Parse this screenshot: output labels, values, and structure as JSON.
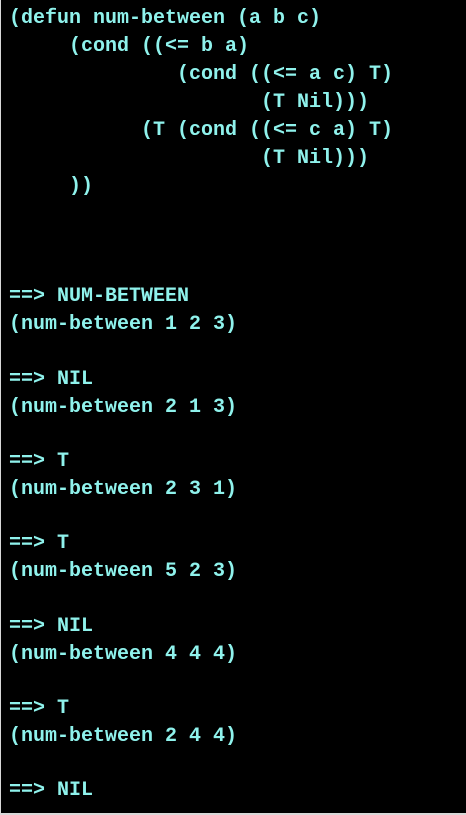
{
  "code": {
    "lines": [
      "(defun num-between (a b c)",
      "     (cond ((<= b a)",
      "              (cond ((<= a c) T)",
      "                     (T Nil)))",
      "           (T (cond ((<= c a) T)",
      "                     (T Nil)))",
      "     ))"
    ]
  },
  "output": {
    "lines": [
      "==> NUM-BETWEEN",
      "(num-between 1 2 3)",
      "",
      "==> NIL",
      "(num-between 2 1 3)",
      "",
      "==> T",
      "(num-between 2 3 1)",
      "",
      "==> T",
      "(num-between 5 2 3)",
      "",
      "==> NIL",
      "(num-between 4 4 4)",
      "",
      "==> T",
      "(num-between 2 4 4)",
      "",
      "==> NIL"
    ]
  },
  "colors": {
    "text": "#8ff2ec",
    "background": "#000000"
  }
}
